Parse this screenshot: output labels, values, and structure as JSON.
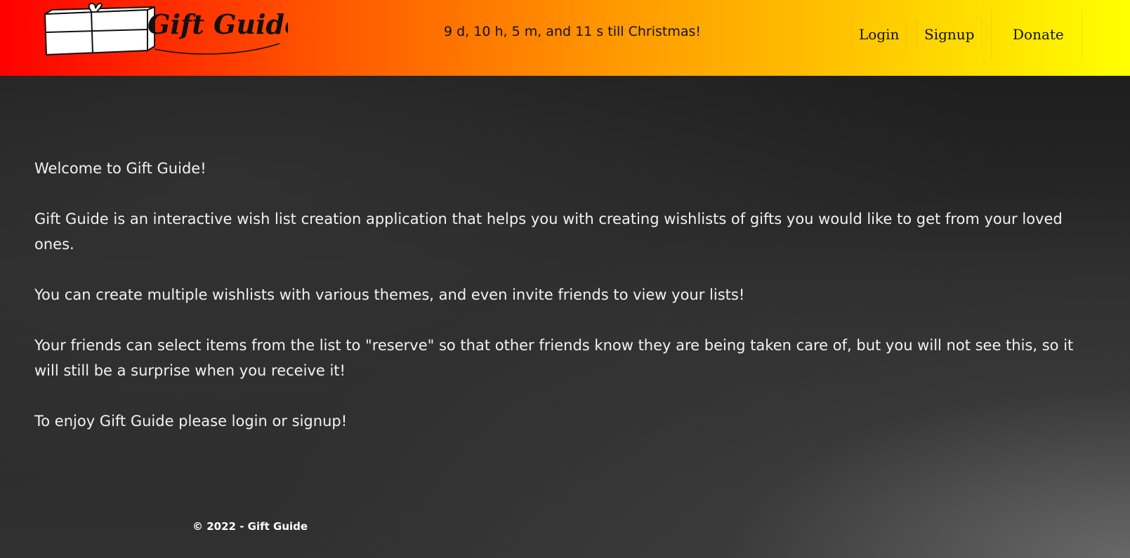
{
  "brand": {
    "logo_text": "Gift Guide"
  },
  "header": {
    "countdown": "9 d, 10 h, 5 m, and 11 s till Christmas!",
    "nav": {
      "login": "Login",
      "signup": "Signup",
      "donate": "Donate"
    }
  },
  "content": {
    "welcome": "Welcome to Gift Guide!",
    "description": "Gift Guide is an interactive wish list creation application that helps you with creating wishlists of gifts you would like to get from your loved ones.",
    "feature": "You can create multiple wishlists with various themes, and even invite friends to view your lists!",
    "reserve": "Your friends can select items from the list to \"reserve\" so that other friends know they are being taken care of, but you will not see this, so it will still be a surprise when you receive it!",
    "cta": "To enjoy Gift Guide please login or signup!"
  },
  "footer": {
    "copyright": "© 2022 - Gift Guide"
  },
  "colors": {
    "header_gradient_start": "#ff0000",
    "header_gradient_end": "#ffff00",
    "background": "#2b2b2b",
    "text": "#f2f2f2"
  },
  "icons": {
    "logo": "gift-box-icon"
  }
}
